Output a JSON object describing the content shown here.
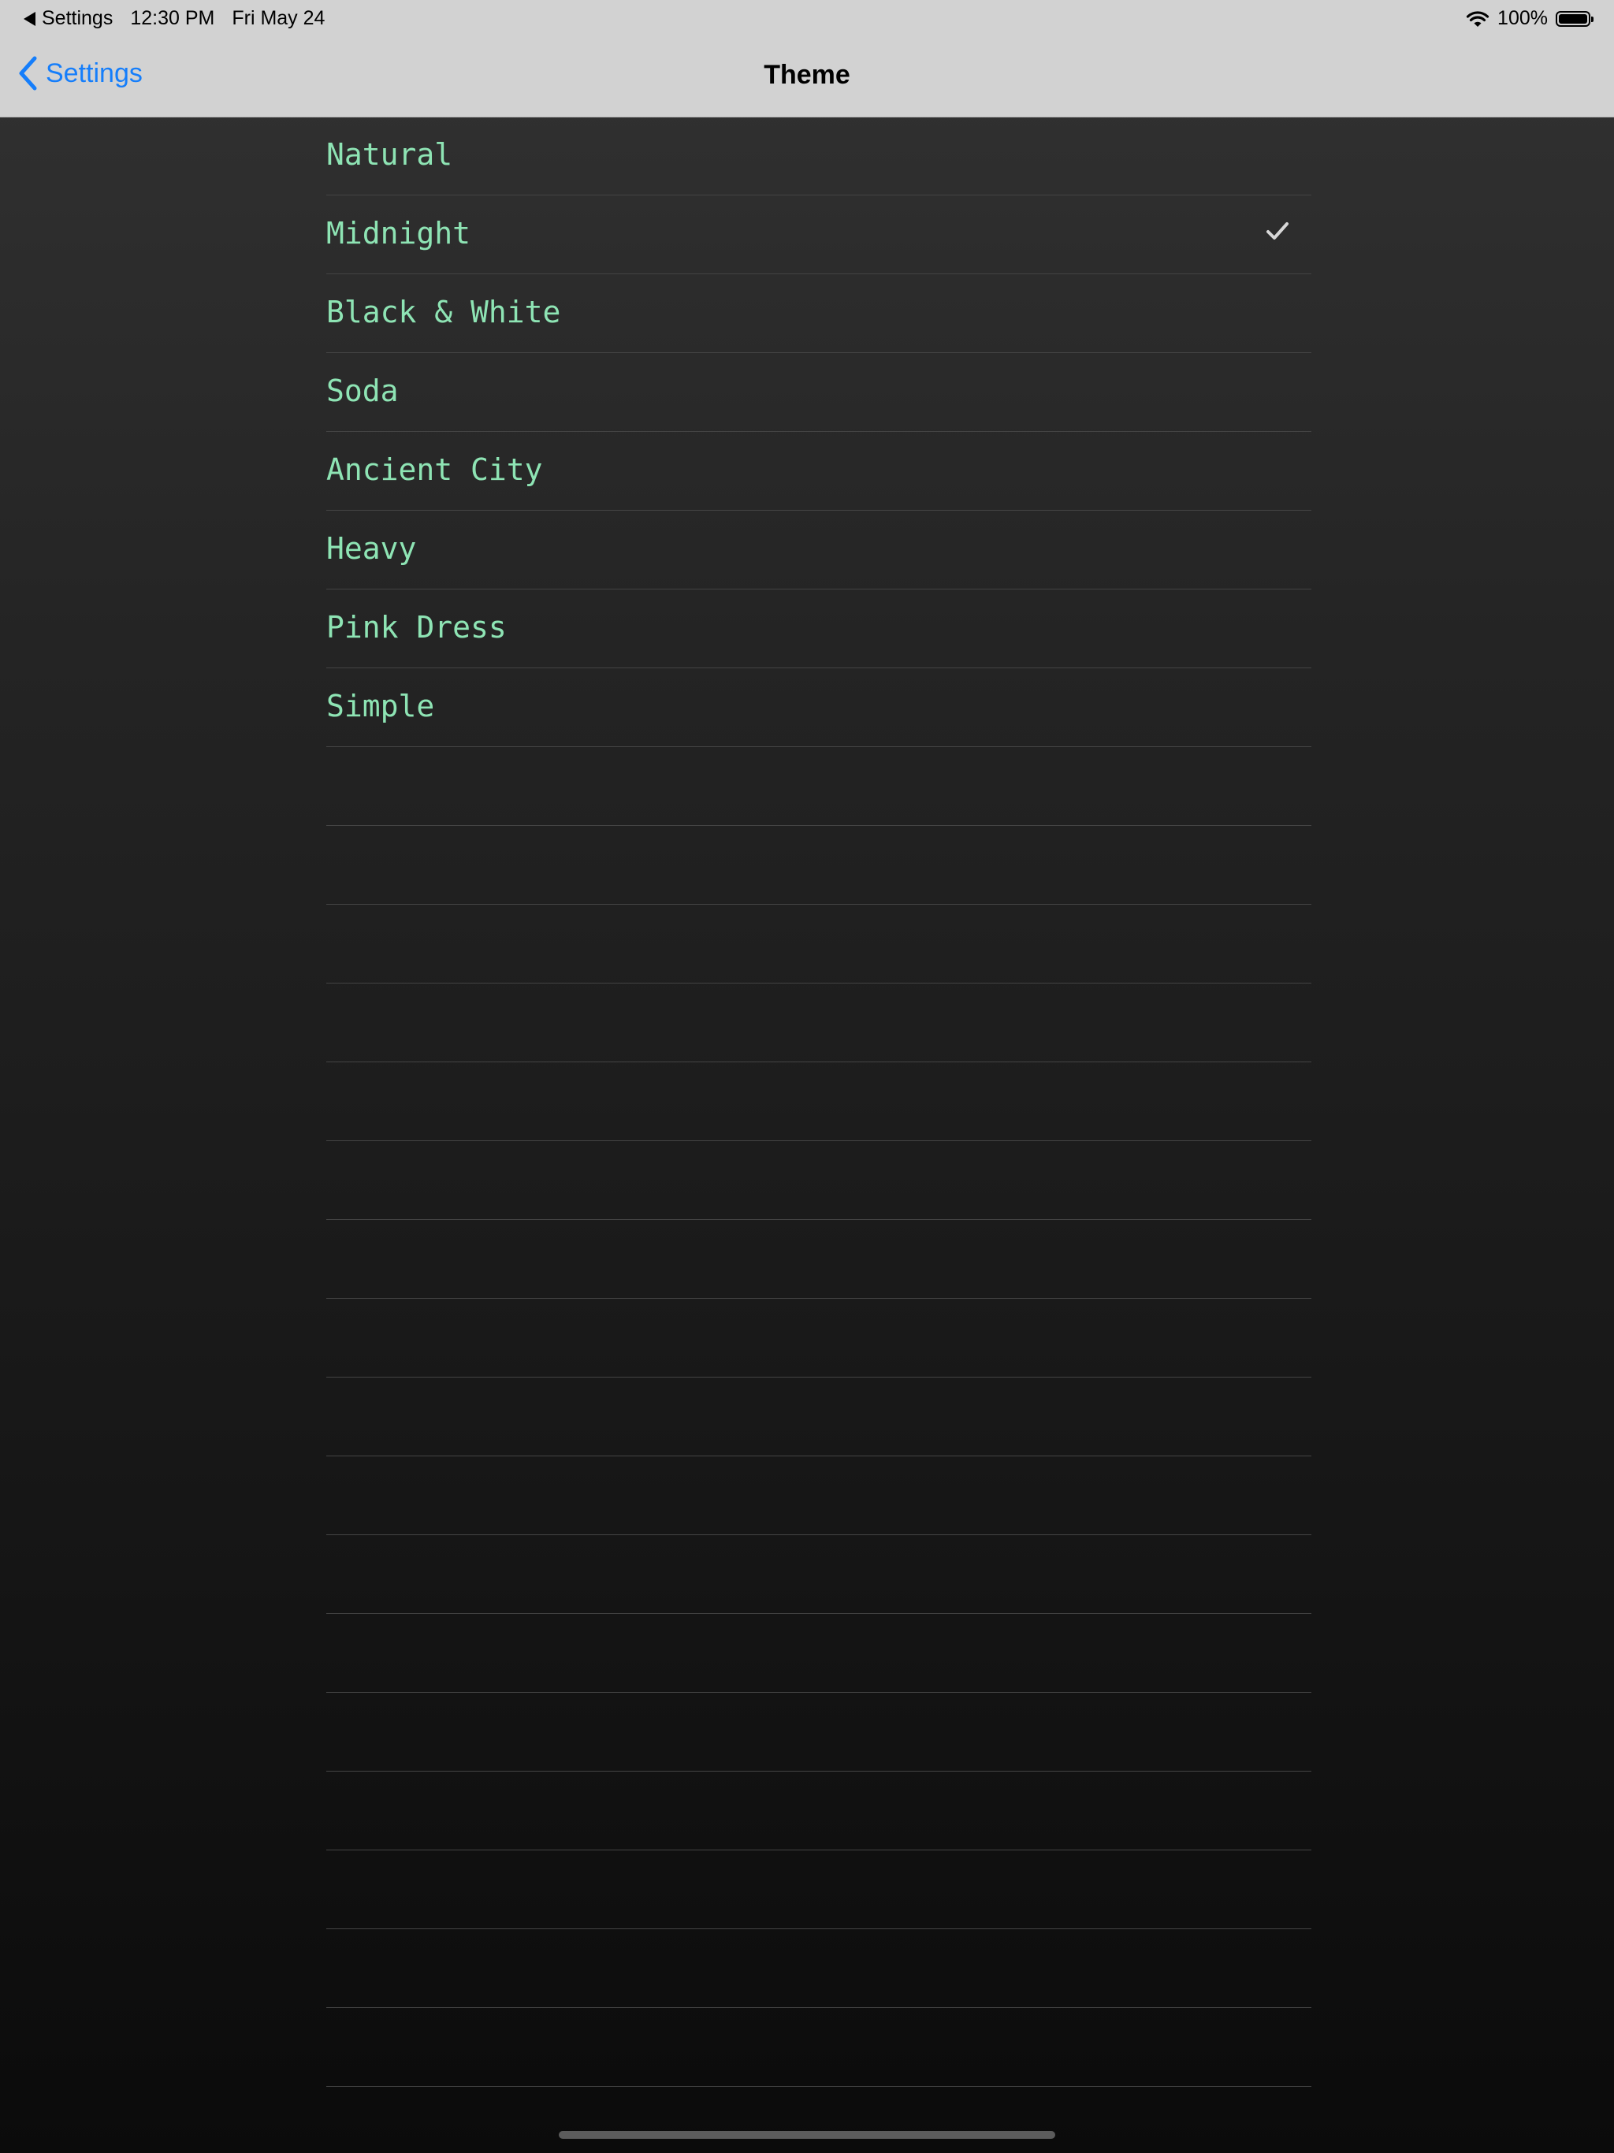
{
  "status_bar": {
    "back_app": "Settings",
    "time": "12:30 PM",
    "date": "Fri May 24",
    "battery": "100%",
    "battery_level": 1.0
  },
  "nav": {
    "back_label": "Settings",
    "title": "Theme"
  },
  "themes": [
    {
      "label": "Natural",
      "selected": false
    },
    {
      "label": "Midnight",
      "selected": true
    },
    {
      "label": "Black & White",
      "selected": false
    },
    {
      "label": "Soda",
      "selected": false
    },
    {
      "label": "Ancient City",
      "selected": false
    },
    {
      "label": "Heavy",
      "selected": false
    },
    {
      "label": "Pink Dress",
      "selected": false
    },
    {
      "label": "Simple",
      "selected": false
    }
  ],
  "colors": {
    "accent": "#157efb",
    "theme_label": "#8ee4b4",
    "checkmark": "#d8d8d8"
  },
  "icons": {
    "back": "chevron-left-icon",
    "selected": "checkmark-icon",
    "wifi": "wifi-icon",
    "battery": "battery-icon"
  }
}
